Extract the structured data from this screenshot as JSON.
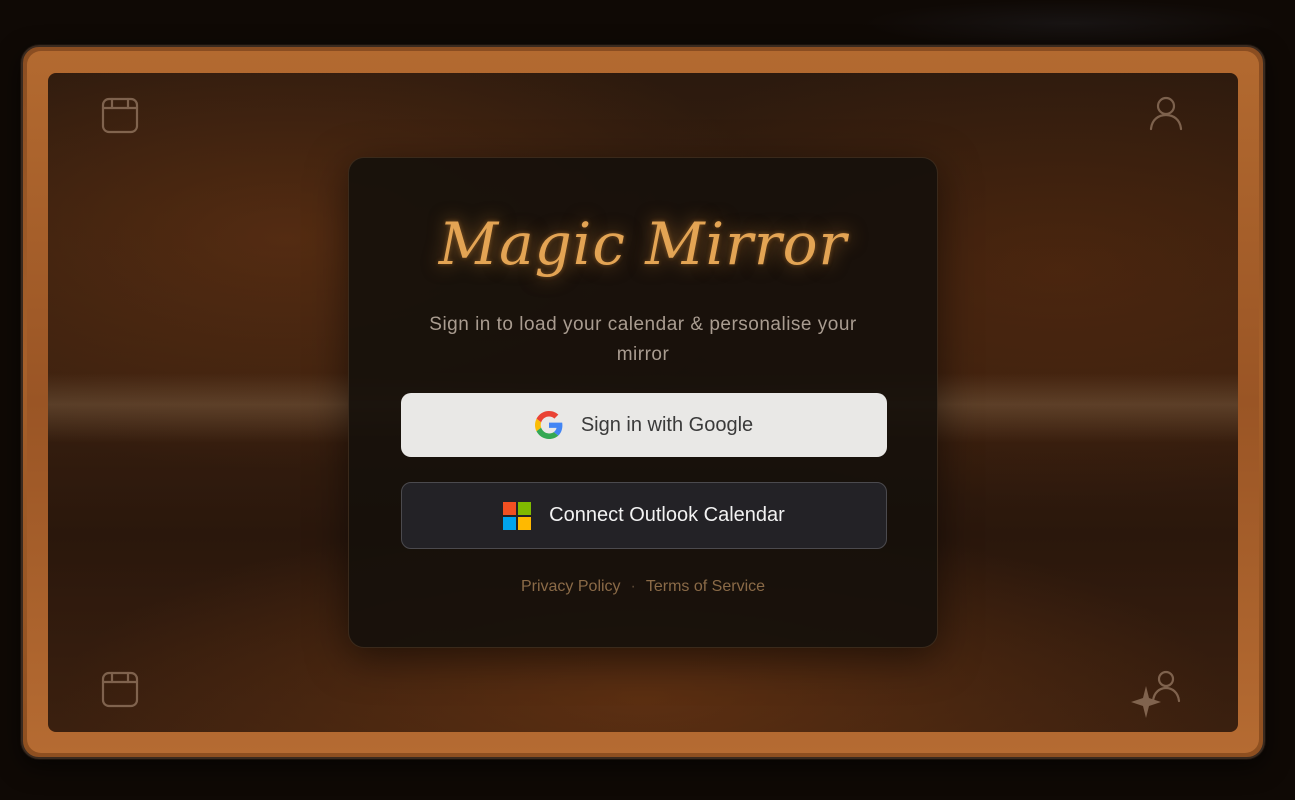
{
  "app": {
    "title": "Magic Mirror",
    "subtitle": "Sign in to load your calendar & personalise your mirror"
  },
  "buttons": {
    "google": {
      "label": "Sign in with Google",
      "icon": "google-g-icon"
    },
    "outlook": {
      "label": "Connect Outlook Calendar",
      "icon": "microsoft-logo-icon"
    }
  },
  "links": {
    "privacy": "Privacy Policy",
    "separator": "·",
    "terms": "Terms of Service"
  },
  "corner_icons": {
    "top_left": "calendar-icon",
    "top_right": "user-icon",
    "bottom_left": "calendar-icon",
    "bottom_right": "user-sparkle-icon"
  },
  "colors": {
    "title_glow": "#e3a454",
    "frame_copper": "#a7602a",
    "card_bg": "#16100b",
    "google_button_bg": "#e9e8e6",
    "outlook_button_bg": "#232226",
    "link_color": "#8a6a47"
  }
}
